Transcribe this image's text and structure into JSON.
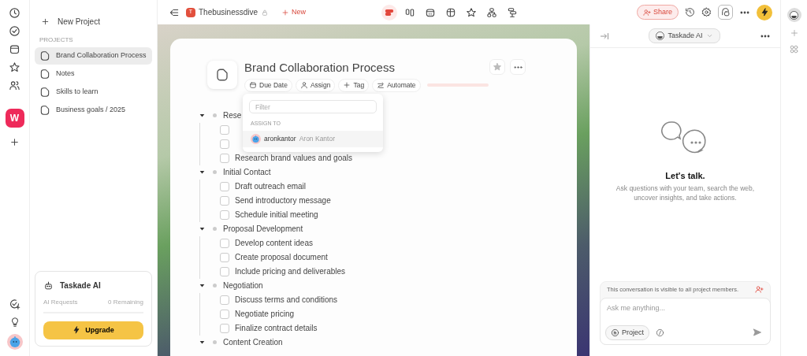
{
  "rail": {
    "workspace": "W"
  },
  "sidebar": {
    "new_project": "New Project",
    "section": "PROJECTS",
    "projects": [
      {
        "label": "Brand Collaboration Process",
        "selected": true
      },
      {
        "label": "Notes",
        "selected": false
      },
      {
        "label": "Skills to learn",
        "selected": false
      },
      {
        "label": "Business goals / 2025",
        "selected": false
      }
    ],
    "ai_card": {
      "title": "Taskade AI",
      "requests_label": "AI Requests",
      "remaining": "0 Remaining",
      "level": 0,
      "upgrade": "Upgrade"
    }
  },
  "topbar": {
    "workspace_initial": "T",
    "workspace": "Thebusinessdive",
    "new": "New",
    "views": [
      {
        "kind": "list",
        "selected": true
      },
      {
        "kind": "board",
        "selected": false
      },
      {
        "kind": "calendar",
        "selected": false
      },
      {
        "kind": "table",
        "selected": false
      },
      {
        "kind": "star",
        "selected": false
      },
      {
        "kind": "org",
        "selected": false
      },
      {
        "kind": "gantt",
        "selected": false
      }
    ],
    "share": "Share"
  },
  "project": {
    "title": "Brand Collaboration Process",
    "actions": [
      {
        "kind": "date",
        "label": "Due Date"
      },
      {
        "kind": "assign",
        "label": "Assign"
      },
      {
        "kind": "tag",
        "label": "Tag"
      },
      {
        "kind": "automate",
        "label": "Automate"
      }
    ],
    "sections": [
      {
        "title": "Rese",
        "expanded": true,
        "tasks": [
          {
            "checked": false
          },
          {
            "checked": false
          },
          {
            "label": "Research brand values and goals",
            "checked": false
          }
        ]
      },
      {
        "title": "Initial Contact",
        "expanded": true,
        "tasks": [
          {
            "label": "Draft outreach email",
            "checked": false
          },
          {
            "label": "Send introductory message",
            "checked": false
          },
          {
            "label": "Schedule initial meeting",
            "checked": false
          }
        ]
      },
      {
        "title": "Proposal Development",
        "expanded": true,
        "tasks": [
          {
            "label": "Develop content ideas",
            "checked": false
          },
          {
            "label": "Create proposal document",
            "checked": false
          },
          {
            "label": "Include pricing and deliverables",
            "checked": false
          }
        ]
      },
      {
        "title": "Negotiation",
        "expanded": true,
        "tasks": [
          {
            "label": "Discuss terms and conditions",
            "checked": false
          },
          {
            "label": "Negotiate pricing",
            "checked": false
          },
          {
            "label": "Finalize contract details",
            "checked": false
          }
        ]
      },
      {
        "title": "Content Creation",
        "expanded": true
      }
    ]
  },
  "assign_menu": {
    "placeholder": "Filter",
    "heading": "ASSIGN TO",
    "users": [
      {
        "username": "aronkantor",
        "name": "Aron Kantor",
        "selected": true
      }
    ]
  },
  "chat": {
    "agent": "Taskade AI",
    "heading": "Let's talk.",
    "description": "Ask questions with your team, search the web, uncover insights, and take actions.",
    "notice": "This conversation is visible to all project members.",
    "placeholder": "Ask me anything...",
    "context": "Project"
  }
}
